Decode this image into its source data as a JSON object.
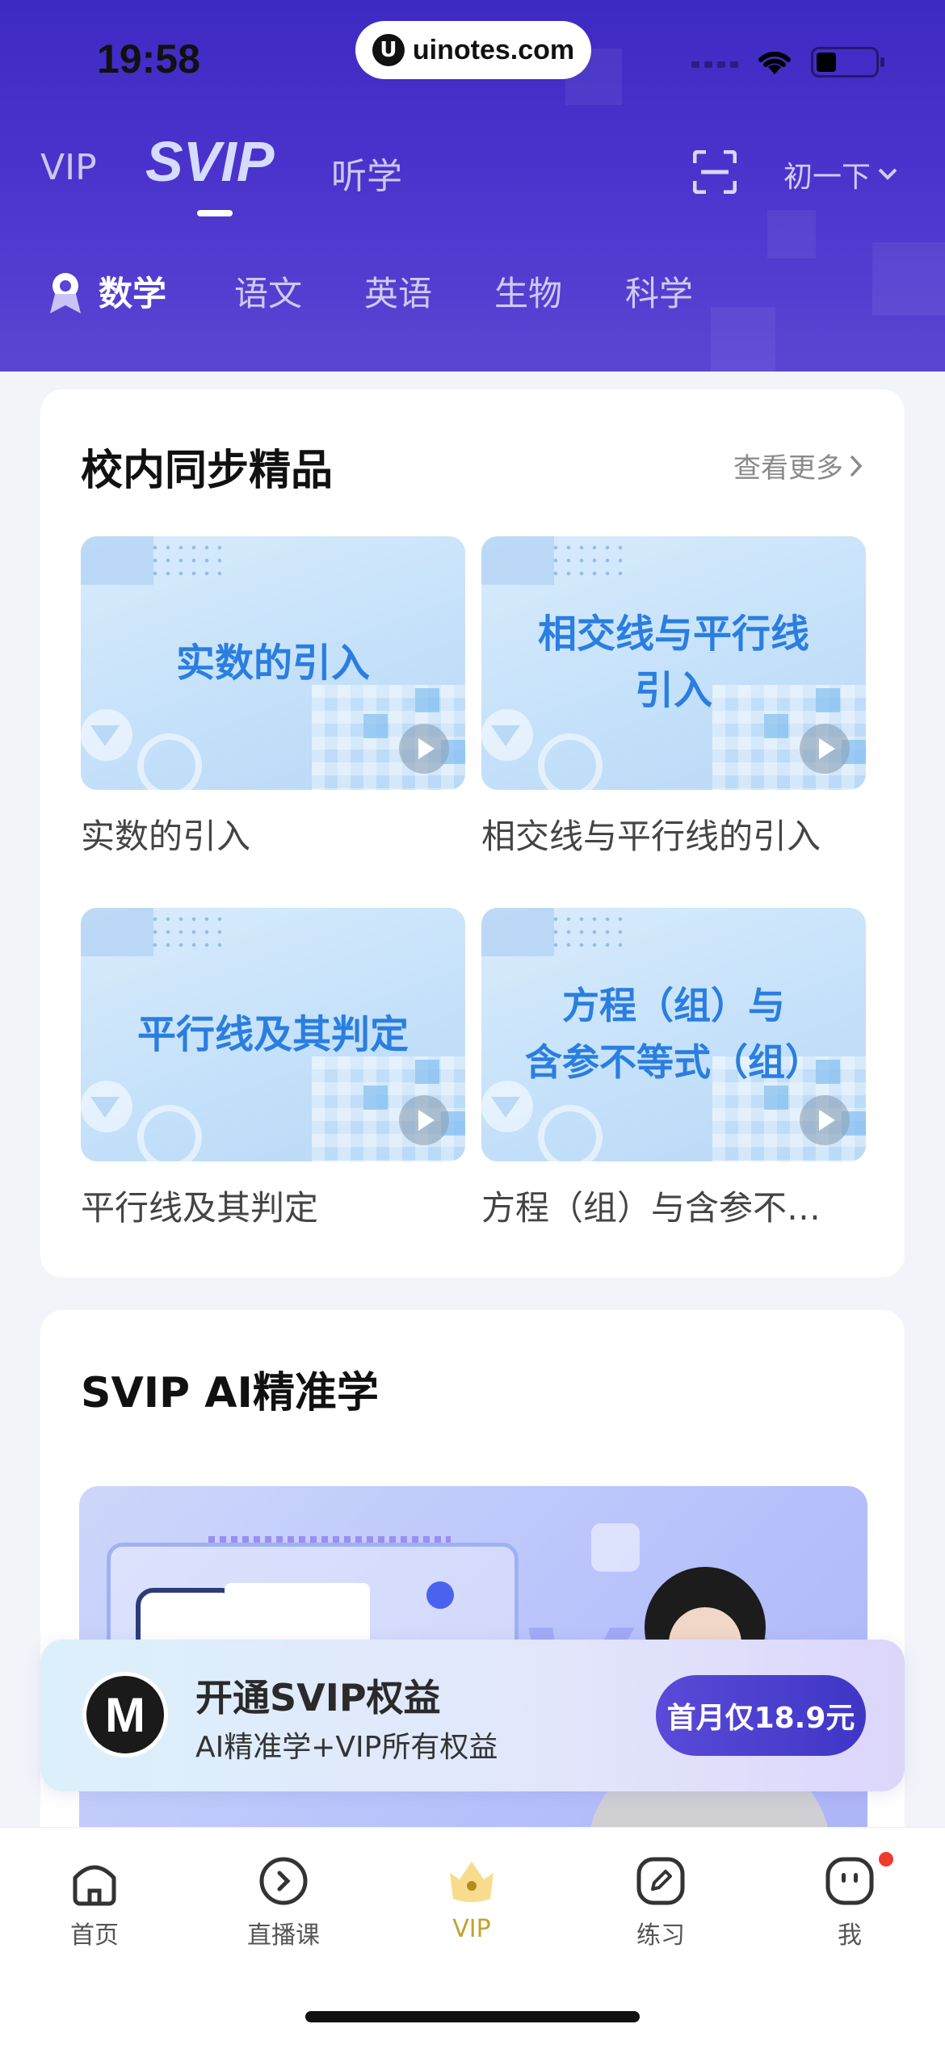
{
  "status_bar": {
    "time": "19:58",
    "watermark_logo": "U",
    "watermark_text": "uinotes.com"
  },
  "top_tabs": [
    {
      "label": "VIP"
    },
    {
      "label": "SVIP"
    },
    {
      "label": "听学"
    }
  ],
  "grade_selector": {
    "label": "初一下"
  },
  "subjects": [
    {
      "label": "数学"
    },
    {
      "label": "语文"
    },
    {
      "label": "英语"
    },
    {
      "label": "生物"
    },
    {
      "label": "科学"
    }
  ],
  "sync_section": {
    "title": "校内同步精品",
    "see_more": "查看更多",
    "lessons": [
      {
        "thumb_lines": [
          "实数的引入"
        ],
        "caption": "实数的引入"
      },
      {
        "thumb_lines": [
          "相交线与平行线",
          "引入"
        ],
        "caption": "相交线与平行线的引入"
      },
      {
        "thumb_lines": [
          "平行线及其判定"
        ],
        "caption": "平行线及其判定"
      },
      {
        "thumb_lines": [
          "方程（组）与",
          "含参不等式（组）"
        ],
        "caption": "方程（组）与含参不…"
      }
    ]
  },
  "ai_section": {
    "title": "SVIP AI精准学"
  },
  "promo": {
    "logo": "M",
    "title": "开通SVIP权益",
    "subtitle": "AI精准学+VIP所有权益",
    "button": "首月仅18.9元"
  },
  "bottom_nav": [
    {
      "label": "首页",
      "icon": "home-icon"
    },
    {
      "label": "直播课",
      "icon": "live-icon"
    },
    {
      "label": "VIP",
      "icon": "crown-icon"
    },
    {
      "label": "练习",
      "icon": "pen-icon"
    },
    {
      "label": "我",
      "icon": "profile-icon"
    }
  ],
  "colors": {
    "header": "#4a33cc",
    "accent": "#3f36c6",
    "thumb_title": "#2a7ee0",
    "vip_active": "#c4a22a"
  }
}
